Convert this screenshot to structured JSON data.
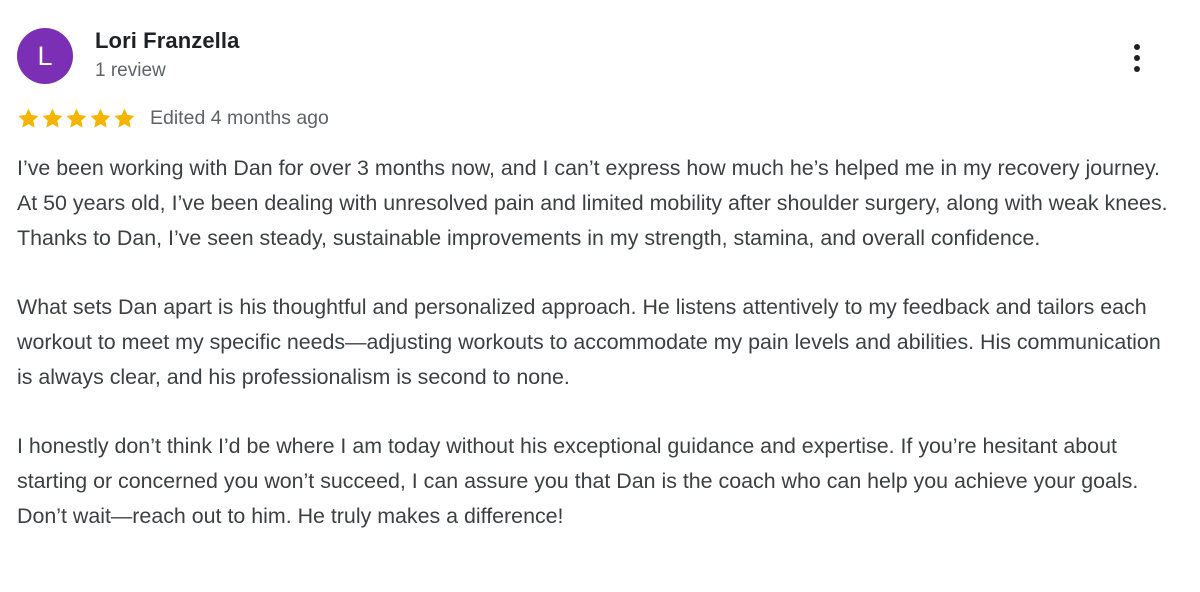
{
  "reviewer": {
    "avatar_initial": "L",
    "name": "Lori Franzella",
    "review_count": "1 review"
  },
  "rating": {
    "stars": 5,
    "max_stars": 5,
    "star_color": "#f4b400",
    "edited": "Edited 4 months ago"
  },
  "review": {
    "paragraphs": [
      "I’ve been working with Dan for over 3 months now, and I can’t express how much he’s helped me in my recovery journey. At 50 years old, I’ve been dealing with unresolved pain and limited mobility after shoulder surgery, along with weak knees. Thanks to Dan, I’ve seen steady, sustainable improvements in my strength, stamina, and overall confidence.",
      "What sets Dan apart is his thoughtful and personalized approach. He listens attentively to my feedback and tailors each workout to meet my specific needs—adjusting workouts to accommodate my pain levels and abilities. His communication is always clear, and his professionalism is second to none.",
      "I honestly don’t think I’d be where I am today without his exceptional guidance and expertise. If you’re hesitant about starting or concerned you won’t succeed, I can assure you that Dan is the coach who can help you achieve your goals. Don’t wait—reach out to him. He truly makes a difference!"
    ]
  },
  "menu": {
    "icon": "more-vertical-icon"
  },
  "colors": {
    "avatar_bg": "#7b2fb5",
    "text_primary": "#202124",
    "text_secondary": "#5f6368"
  }
}
